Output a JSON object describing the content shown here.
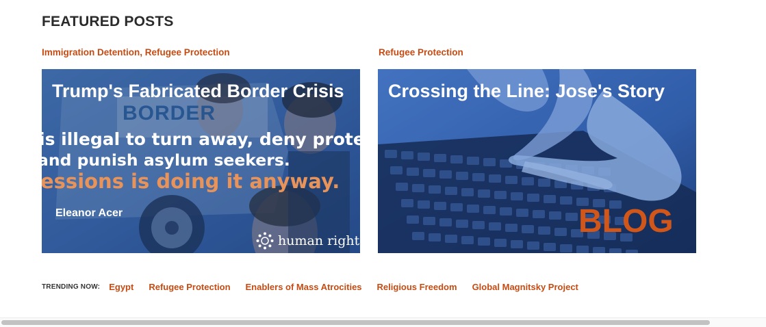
{
  "section": {
    "title": "FEATURED POSTS"
  },
  "posts": [
    {
      "categories": [
        "Immigration Detention",
        "Refugee Protection"
      ],
      "separator": ",",
      "title": "Trump's Fabricated Border Crisis",
      "image_text": {
        "sign": "BORDER",
        "quote_lines": [
          "is illegal to turn away, deny protection",
          "and punish asylum seekers.",
          "essions is doing it anyway."
        ],
        "author": "Eleanor Acer",
        "brand": "human rights"
      }
    },
    {
      "categories": [
        "Refugee Protection"
      ],
      "title": "Crossing the Line: Jose's Story",
      "image_text": {
        "badge": "BLOG"
      }
    }
  ],
  "trending": {
    "label": "TRENDING NOW:",
    "links": [
      "Egypt",
      "Refugee Protection",
      "Enablers of Mass Atrocities",
      "Religious Freedom",
      "Global Magnitsky Project"
    ]
  },
  "colors": {
    "accent": "#c64b13",
    "card_blue": "#3a66b5",
    "dark_blue": "#1b3a72",
    "quote_orange": "#e8935a",
    "blog_orange": "#d1561a"
  }
}
